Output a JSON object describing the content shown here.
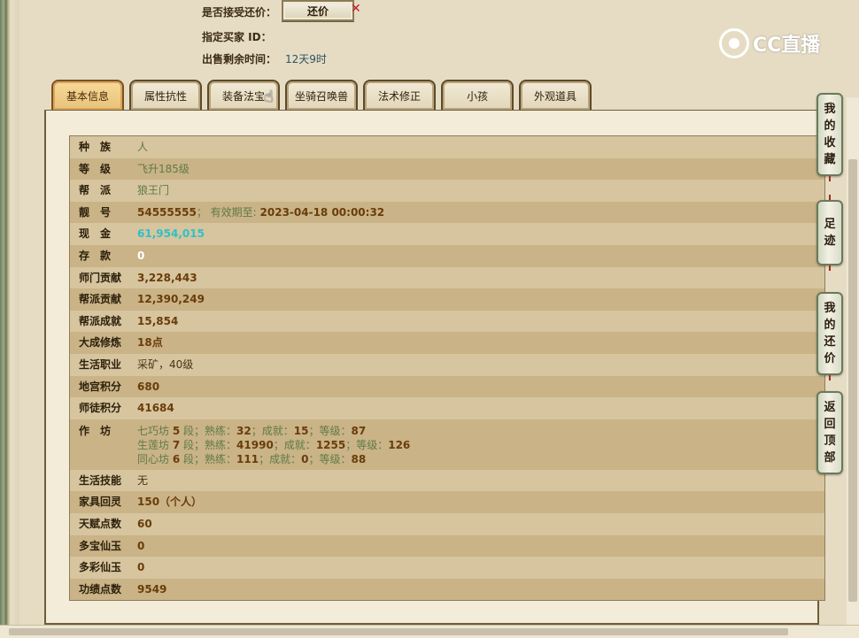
{
  "top": {
    "accept_counter_label": "是否接受还价：",
    "counter_button": "还价",
    "close_symbol": "✕",
    "buyer_id_label": "指定买家 ID：",
    "remaining_label": "出售剩余时间：",
    "remaining_value": "12天9时"
  },
  "logo": {
    "text": "CC直播"
  },
  "tabs": [
    "基本信息",
    "属性抗性",
    "装备法宝",
    "坐骑召唤兽",
    "法术修正",
    "小孩",
    "外观道具"
  ],
  "rows": {
    "race": {
      "label": "种　族",
      "value": "人"
    },
    "level": {
      "label": "等　级",
      "value": "飞升185级"
    },
    "faction": {
      "label": "帮　派",
      "value": "狼王门"
    },
    "pretty": {
      "label": "靓　号",
      "value": "54555555",
      "sep": "；",
      "valid_label": "有效期至:",
      "valid_value": "2023-04-18 00:00:32"
    },
    "cash": {
      "label": "现　金",
      "value": "61,954,015"
    },
    "deposit": {
      "label": "存　款",
      "value": "0"
    },
    "sect_contrib": {
      "label": "师门贡献",
      "value": "3,228,443"
    },
    "faction_contrib": {
      "label": "帮派贡献",
      "value": "12,390,249"
    },
    "faction_achieve": {
      "label": "帮派成就",
      "value": "15,854"
    },
    "cultivation": {
      "label": "大成修炼",
      "value": "18点"
    },
    "life_job": {
      "label": "生活职业",
      "value": "采矿，40级"
    },
    "dungeon_points": {
      "label": "地宫积分",
      "value": "680"
    },
    "mentor_points": {
      "label": "师徒积分",
      "value": "41684"
    },
    "workshop": {
      "label": "作　坊",
      "lines": [
        {
          "name": "七巧坊",
          "seg": "5",
          "seg_u": "段；熟练：",
          "skill": "32",
          "ach_l": "；成就：",
          "ach": "15",
          "lvl_l": "；等级：",
          "lvl": "87"
        },
        {
          "name": "生莲坊",
          "seg": "7",
          "seg_u": "段；熟练：",
          "skill": "41990",
          "ach_l": "；成就：",
          "ach": "1255",
          "lvl_l": "；等级：",
          "lvl": "126"
        },
        {
          "name": "同心坊",
          "seg": "6",
          "seg_u": "段；熟练：",
          "skill": "111",
          "ach_l": "；成就：",
          "ach": "0",
          "lvl_l": "；等级：",
          "lvl": "88"
        }
      ]
    },
    "life_skill": {
      "label": "生活技能",
      "value": "无"
    },
    "furniture": {
      "label": "家具回灵",
      "value": "150（个人）"
    },
    "talent": {
      "label": "天赋点数",
      "value": "60"
    },
    "duobao": {
      "label": "多宝仙玉",
      "value": "0"
    },
    "duocai": {
      "label": "多彩仙玉",
      "value": "0"
    },
    "merit": {
      "label": "功绩点数",
      "value": "9549"
    }
  },
  "side": {
    "favorites": [
      "我",
      "的",
      "收",
      "藏"
    ],
    "footprint": [
      "足",
      "迹"
    ],
    "my_counter": [
      "我",
      "的",
      "还",
      "价"
    ],
    "back_top": [
      "返",
      "回",
      "顶",
      "部"
    ]
  }
}
